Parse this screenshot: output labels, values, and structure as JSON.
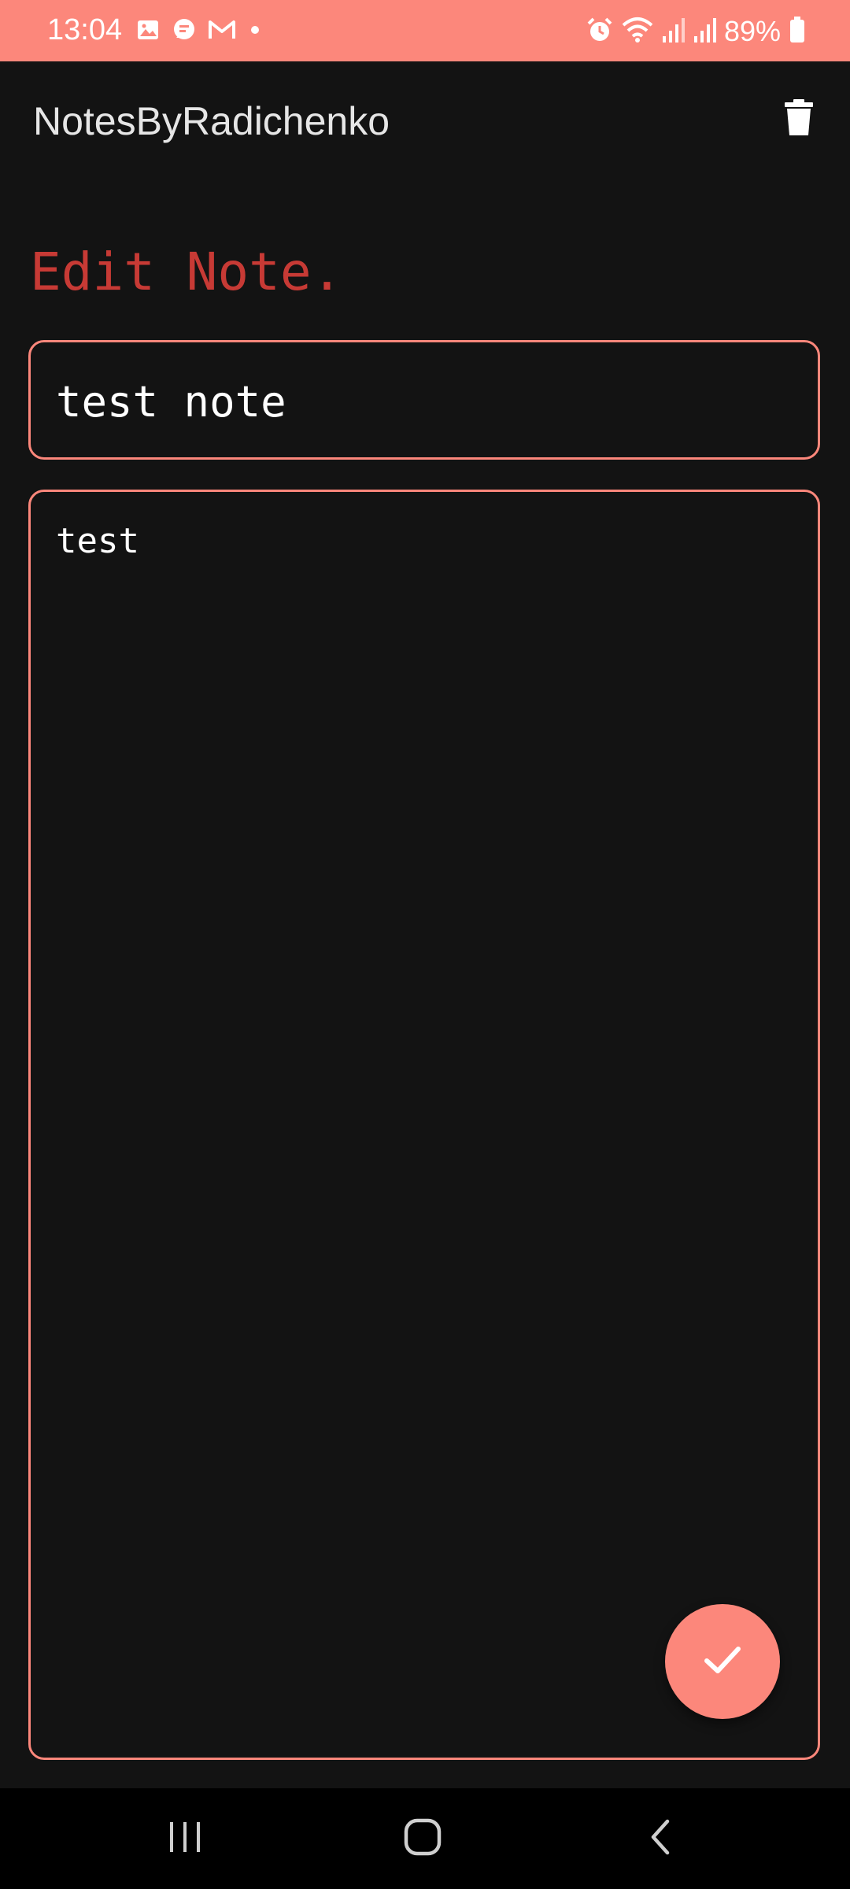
{
  "status_bar": {
    "time": "13:04",
    "battery": "89%",
    "left_icons": [
      "gallery-icon",
      "chat-icon",
      "gmail-icon",
      "dot-icon"
    ],
    "right_icons": [
      "alarm-icon",
      "wifi-icon",
      "signal-icon",
      "signal-icon",
      "battery-icon"
    ]
  },
  "app_bar": {
    "title": "NotesByRadichenko",
    "delete_icon": "trash-icon"
  },
  "editor": {
    "heading": "Edit Note.",
    "title_value": "test note",
    "body_value": "test"
  },
  "fab": {
    "icon": "check-icon"
  },
  "nav_bar": {
    "buttons": [
      "recents-icon",
      "home-icon",
      "back-icon"
    ]
  },
  "colors": {
    "accent": "#fc877b",
    "heading": "#c73a35",
    "background": "#131313",
    "nav_background": "#000000"
  }
}
